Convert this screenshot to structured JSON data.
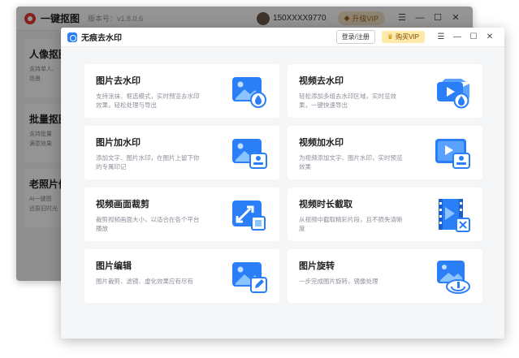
{
  "back_window": {
    "app_name": "一键抠图",
    "version": "版本号：v1.8.0.6",
    "phone": "150XXXX9770",
    "vip_label": "升级VIP",
    "cards": [
      {
        "title": "人像抠图",
        "desc": [
          "支持单人、",
          "场景"
        ]
      },
      {
        "title": "批量抠图",
        "desc": [
          "支持批量",
          "满意效果"
        ]
      },
      {
        "title": "老照片修复",
        "desc": [
          "AI一键图",
          "还原旧时光"
        ]
      }
    ]
  },
  "front_window": {
    "title": "无痕去水印",
    "login_label": "登录/注册",
    "buy_label": "购买VIP",
    "tools": [
      {
        "title": "图片去水印",
        "desc": "支持涂抹、框选模式，实时预览去水印效果，轻松处理与导出",
        "icon": "image-remove-watermark-icon"
      },
      {
        "title": "视频去水印",
        "desc": "轻松添加多组去水印区域，实时览效果，一键快速导出",
        "icon": "video-remove-watermark-icon"
      },
      {
        "title": "图片加水印",
        "desc": "添加文字、图片水印，在图片上留下你的专属印记",
        "icon": "image-add-watermark-icon"
      },
      {
        "title": "视频加水印",
        "desc": "为视频添加文字、图片水印，实时预览效果",
        "icon": "video-add-watermark-icon"
      },
      {
        "title": "视频画面裁剪",
        "desc": "裁剪视频画面大小，以适合在各个平台播放",
        "icon": "video-crop-icon"
      },
      {
        "title": "视频时长截取",
        "desc": "从视频中截取精彩片段，且不损失清晰度",
        "icon": "video-trim-icon"
      },
      {
        "title": "图片编辑",
        "desc": "图片裁剪、滤镜、虚化效果应有尽有",
        "icon": "image-edit-icon"
      },
      {
        "title": "图片旋转",
        "desc": "一步完成图片旋转，镜像处理",
        "icon": "image-rotate-icon"
      }
    ]
  },
  "colors": {
    "accent": "#2b7ff6",
    "icon_light": "#8cc4ff",
    "vip_bg": "#fde9a8"
  }
}
